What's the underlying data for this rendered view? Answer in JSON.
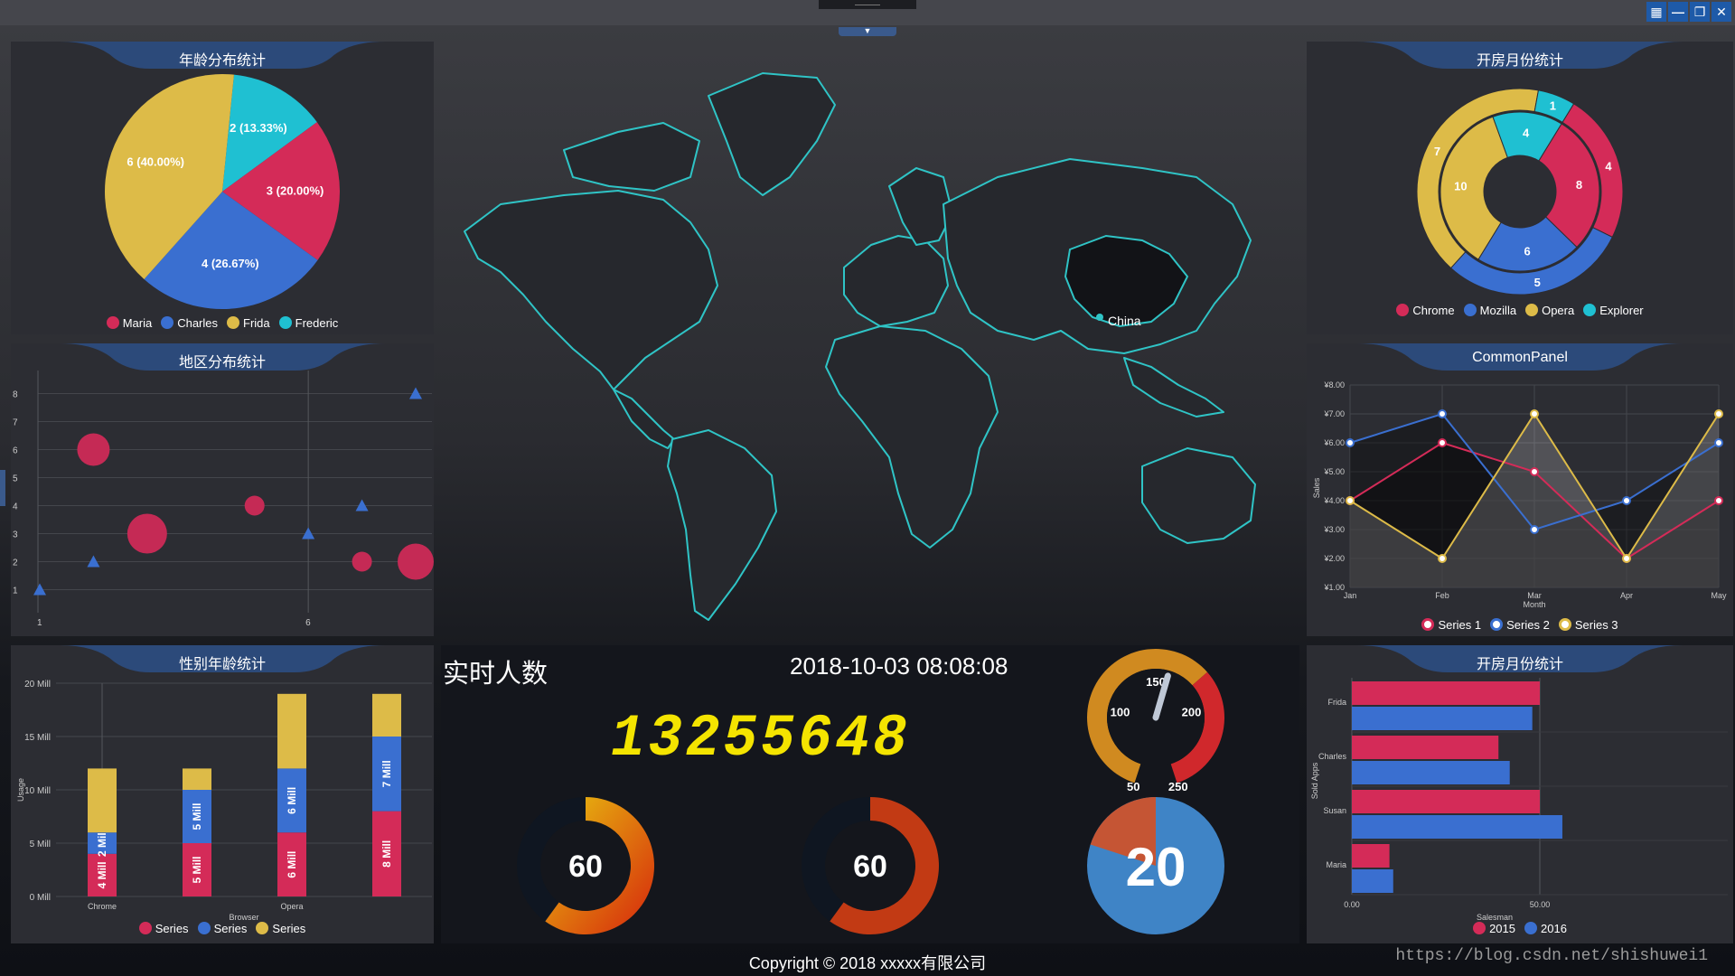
{
  "window": {
    "toggle_icon": "chevron-down-icon",
    "controls": [
      "layout-icon",
      "minimize-icon",
      "restore-icon",
      "close-icon"
    ],
    "control_glyphs": [
      "▦",
      "—",
      "❐",
      "✕"
    ]
  },
  "age_panel": {
    "title": "年龄分布统计",
    "chart_data": {
      "type": "pie",
      "slices": [
        {
          "name": "Maria",
          "value": 3,
          "label": "3 (20.00%)",
          "color": "#d42b58"
        },
        {
          "name": "Charles",
          "value": 4,
          "label": "4 (26.67%)",
          "color": "#3a6fd0"
        },
        {
          "name": "Frida",
          "value": 6,
          "label": "6 (40.00%)",
          "color": "#ddbb48"
        },
        {
          "name": "Frederic",
          "value": 2,
          "label": "2 (13.33%)",
          "color": "#1fc0d2"
        }
      ]
    },
    "legend": [
      {
        "name": "Maria",
        "color": "#d42b58"
      },
      {
        "name": "Charles",
        "color": "#3a6fd0"
      },
      {
        "name": "Frida",
        "color": "#ddbb48"
      },
      {
        "name": "Frederic",
        "color": "#1fc0d2"
      }
    ]
  },
  "region_panel": {
    "title": "地区分布统计",
    "chart_data": {
      "type": "scatter",
      "x_ticks": [
        "1",
        "6"
      ],
      "y_ticks": [
        "1",
        "2",
        "3",
        "4",
        "5",
        "6",
        "7",
        "8"
      ],
      "xlim": [
        1,
        8
      ],
      "ylim": [
        0.5,
        8.5
      ],
      "series": [
        {
          "marker": "circle",
          "color": "#c52a55",
          "points": [
            {
              "x": 2,
              "y": 6,
              "size": 18
            },
            {
              "x": 3,
              "y": 3,
              "size": 22
            },
            {
              "x": 5,
              "y": 4,
              "size": 11
            },
            {
              "x": 7,
              "y": 2,
              "size": 11
            },
            {
              "x": 8,
              "y": 2,
              "size": 20
            }
          ]
        },
        {
          "marker": "triangle",
          "color": "#3a6fd0",
          "points": [
            {
              "x": 1,
              "y": 1
            },
            {
              "x": 2,
              "y": 2
            },
            {
              "x": 6,
              "y": 3
            },
            {
              "x": 7,
              "y": 4
            },
            {
              "x": 8,
              "y": 8
            }
          ]
        }
      ]
    }
  },
  "gender_panel": {
    "title": "性别年龄统计",
    "chart_data": {
      "type": "bar",
      "stacked": true,
      "categories": [
        "Chrome",
        "",
        "Opera",
        ""
      ],
      "x_tick_labels": [
        "Chrome",
        "Opera"
      ],
      "xlabel": "Browser",
      "ylabel": "Usage",
      "y_ticks": [
        "0 Mill",
        "5 Mill",
        "10 Mill",
        "15 Mill",
        "20 Mill"
      ],
      "ylim": [
        0,
        20
      ],
      "series": [
        {
          "name": "Series",
          "color": "#d42b58",
          "values": [
            4,
            5,
            6,
            8
          ],
          "labels": [
            "4 Mill",
            "5 Mill",
            "6 Mill",
            "8 Mill"
          ]
        },
        {
          "name": "Series",
          "color": "#3a6fd0",
          "values": [
            2,
            5,
            6,
            7
          ],
          "labels": [
            "2 Mill",
            "5 Mill",
            "6 Mill",
            "7 Mill"
          ]
        },
        {
          "name": "Series",
          "color": "#ddbb48",
          "values": [
            6,
            2,
            7,
            4
          ],
          "labels": [
            "",
            "",
            "",
            ""
          ]
        }
      ]
    },
    "legend": [
      {
        "name": "Series",
        "color": "#d42b58"
      },
      {
        "name": "Series",
        "color": "#3a6fd0"
      },
      {
        "name": "Series",
        "color": "#ddbb48"
      }
    ]
  },
  "map": {
    "highlight_label": "China",
    "land_color": "#26282d",
    "border_color": "#2fc4c6",
    "highlight_color": "#121317"
  },
  "stats": {
    "title": "实时人数",
    "timestamp": "2018-10-03 08:08:08",
    "counter": "13255648",
    "gauge": {
      "min": 50,
      "max": 250,
      "value": 160,
      "tick_labels": [
        "50",
        "100",
        "150",
        "200",
        "250"
      ]
    },
    "donut_left": {
      "value": "60",
      "percent": 60
    },
    "donut_mid": {
      "value": "60",
      "percent": 60
    },
    "pie_big": {
      "value": "20",
      "percent": 20
    }
  },
  "browser_panel": {
    "title": "开房月份统计",
    "chart_data": {
      "type": "pie",
      "rings": [
        {
          "ring": "outer",
          "slices": [
            {
              "name": "Chrome",
              "value": 4
            },
            {
              "name": "Mozilla",
              "value": 5
            },
            {
              "name": "Opera",
              "value": 7
            },
            {
              "name": "Explorer",
              "value": 1
            }
          ]
        },
        {
          "ring": "inner",
          "slices": [
            {
              "name": "Chrome",
              "value": 8
            },
            {
              "name": "Mozilla",
              "value": 6
            },
            {
              "name": "Opera",
              "value": 10
            },
            {
              "name": "Explorer",
              "value": 4
            }
          ]
        }
      ]
    },
    "legend": [
      {
        "name": "Chrome",
        "color": "#d42b58"
      },
      {
        "name": "Mozilla",
        "color": "#3a6fd0"
      },
      {
        "name": "Opera",
        "color": "#ddbb48"
      },
      {
        "name": "Explorer",
        "color": "#1fc0d2"
      }
    ]
  },
  "common_panel": {
    "title": "CommonPanel",
    "chart_data": {
      "type": "line",
      "categories": [
        "Jan",
        "Feb",
        "Mar",
        "Apr",
        "May"
      ],
      "xlabel": "Month",
      "ylabel": "Sales",
      "y_ticks": [
        "¥1.00",
        "¥2.00",
        "¥3.00",
        "¥4.00",
        "¥5.00",
        "¥6.00",
        "¥7.00",
        "¥8.00"
      ],
      "ylim": [
        1,
        8
      ],
      "series": [
        {
          "name": "Series 1",
          "color": "#d42b58",
          "values": [
            4,
            6,
            5,
            2,
            4
          ]
        },
        {
          "name": "Series 2",
          "color": "#3a6fd0",
          "values": [
            6,
            7,
            3,
            4,
            6
          ]
        },
        {
          "name": "Series 3",
          "color": "#ddbb48",
          "values": [
            4,
            2,
            7,
            2,
            7
          ]
        }
      ]
    },
    "legend": [
      {
        "name": "Series 1",
        "color": "#d42b58"
      },
      {
        "name": "Series 2",
        "color": "#3a6fd0"
      },
      {
        "name": "Series 3",
        "color": "#ddbb48"
      }
    ]
  },
  "salesman_panel": {
    "title": "开房月份统计",
    "chart_data": {
      "type": "bar",
      "orientation": "horizontal",
      "categories": [
        "Frida",
        "Charles",
        "Susan",
        "Maria"
      ],
      "xlabel": "Salesman",
      "ylabel": "Sold Apps",
      "x_ticks": [
        "0.00",
        "50.00"
      ],
      "xlim": [
        0,
        100
      ],
      "series": [
        {
          "name": "2015",
          "color": "#d42b58",
          "values": [
            50,
            39,
            50,
            10
          ]
        },
        {
          "name": "2016",
          "color": "#3a6fd0",
          "values": [
            48,
            42,
            56,
            11
          ]
        }
      ]
    },
    "legend": [
      {
        "name": "2015",
        "color": "#d42b58"
      },
      {
        "name": "2016",
        "color": "#3a6fd0"
      }
    ]
  },
  "footer": {
    "copyright": "Copyright © 2018 xxxxx有限公司",
    "watermark": "https://blog.csdn.net/shishuwei1"
  }
}
